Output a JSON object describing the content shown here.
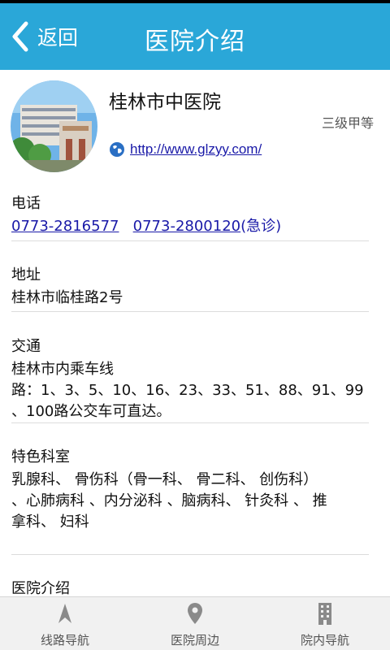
{
  "header": {
    "back_label": "返回",
    "title": "医院介绍"
  },
  "hospital": {
    "name": "桂林市中医院",
    "level": "三级甲等",
    "website": "http://www.glzyy.com/"
  },
  "phone": {
    "label": "电话",
    "number1": "0773-2816577",
    "number2": "0773-2800120",
    "emergency_note": "(急诊)"
  },
  "address": {
    "label": "地址",
    "text": "桂林市临桂路2号"
  },
  "transport": {
    "label": "交通",
    "line1": "桂林市内乘车线",
    "line2": "路：1、3、5、10、16、23、33、51、88、91、99",
    "line3": "、100路公交车可直达。"
  },
  "departments": {
    "label": "特色科室",
    "line1": "乳腺科、 骨伤科（骨一科、 骨二科、 创伤科）",
    "line2": "、心肺病科 、内分泌科 、脑病科、 针灸科 、 推",
    "line3": "拿科、 妇科"
  },
  "intro": {
    "label": "医院介绍"
  },
  "tabs": [
    {
      "label": "线路导航",
      "icon": "navigation-arrow-icon"
    },
    {
      "label": "医院周边",
      "icon": "map-pin-icon"
    },
    {
      "label": "院内导航",
      "icon": "building-icon"
    }
  ]
}
